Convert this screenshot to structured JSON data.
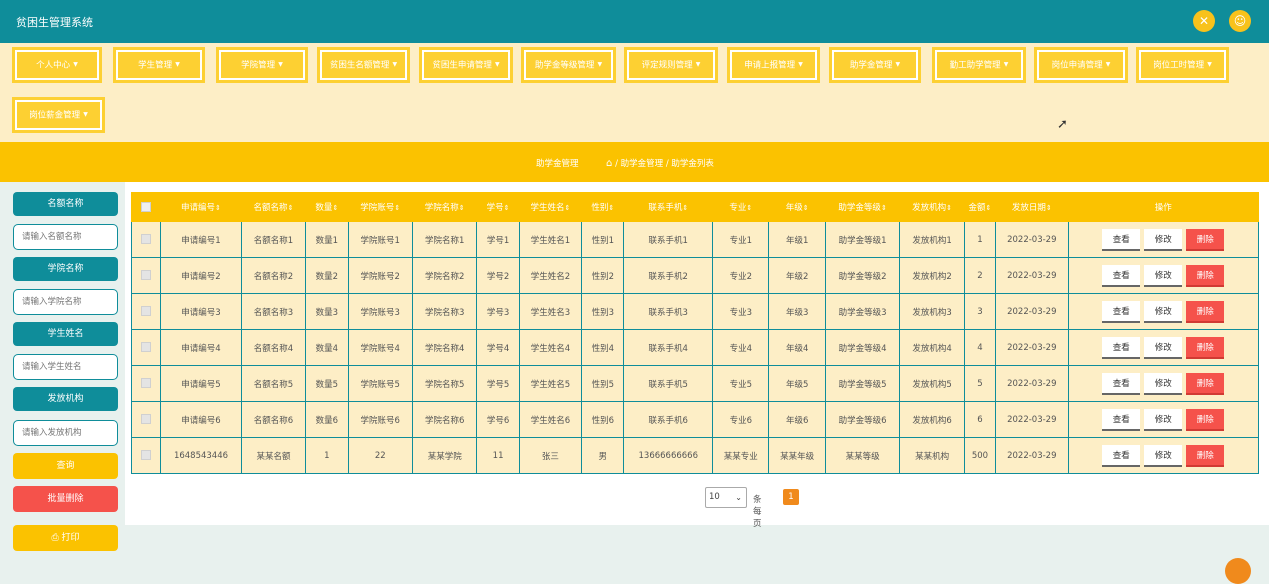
{
  "app": {
    "title": "贫困生管理系统",
    "accent": "#0f8d9a",
    "nav_yellow": "#fdd032",
    "danger": "#f5524b"
  },
  "top_icons": [
    "fullscreen-icon",
    "user-icon"
  ],
  "nav": [
    "个人中心",
    "学生管理",
    "学院管理",
    "贫困生名额管理",
    "贫困生申请管理",
    "助学金等级管理",
    "评定规则管理",
    "申请上报管理",
    "助学金管理",
    "勤工助学管理",
    "岗位申请管理",
    "岗位工时管理",
    "岗位薪金管理"
  ],
  "breadcrumb": {
    "title": "助学金管理",
    "path": "/ 助学金管理 / 助学金列表"
  },
  "filters": [
    {
      "label": "名额名称",
      "placeholder": "请输入名额名称"
    },
    {
      "label": "学院名称",
      "placeholder": "请输入学院名称"
    },
    {
      "label": "学生姓名",
      "placeholder": "请输入学生姓名"
    },
    {
      "label": "发放机构",
      "placeholder": "请输入发放机构"
    }
  ],
  "buttons": {
    "search": "查询",
    "batch_delete": "批量删除",
    "print": "打印"
  },
  "table": {
    "columns": [
      "申请编号",
      "名额名称",
      "数量",
      "学院账号",
      "学院名称",
      "学号",
      "学生姓名",
      "性别",
      "联系手机",
      "专业",
      "年级",
      "助学金等级",
      "发放机构",
      "金额",
      "发放日期",
      "操作"
    ],
    "ops": {
      "view": "查看",
      "edit": "修改",
      "delete": "删除"
    },
    "rows": [
      [
        "申请编号1",
        "名额名称1",
        "数量1",
        "学院账号1",
        "学院名称1",
        "学号1",
        "学生姓名1",
        "性别1",
        "联系手机1",
        "专业1",
        "年级1",
        "助学金等级1",
        "发放机构1",
        "1",
        "2022-03-29"
      ],
      [
        "申请编号2",
        "名额名称2",
        "数量2",
        "学院账号2",
        "学院名称2",
        "学号2",
        "学生姓名2",
        "性别2",
        "联系手机2",
        "专业2",
        "年级2",
        "助学金等级2",
        "发放机构2",
        "2",
        "2022-03-29"
      ],
      [
        "申请编号3",
        "名额名称3",
        "数量3",
        "学院账号3",
        "学院名称3",
        "学号3",
        "学生姓名3",
        "性别3",
        "联系手机3",
        "专业3",
        "年级3",
        "助学金等级3",
        "发放机构3",
        "3",
        "2022-03-29"
      ],
      [
        "申请编号4",
        "名额名称4",
        "数量4",
        "学院账号4",
        "学院名称4",
        "学号4",
        "学生姓名4",
        "性别4",
        "联系手机4",
        "专业4",
        "年级4",
        "助学金等级4",
        "发放机构4",
        "4",
        "2022-03-29"
      ],
      [
        "申请编号5",
        "名额名称5",
        "数量5",
        "学院账号5",
        "学院名称5",
        "学号5",
        "学生姓名5",
        "性别5",
        "联系手机5",
        "专业5",
        "年级5",
        "助学金等级5",
        "发放机构5",
        "5",
        "2022-03-29"
      ],
      [
        "申请编号6",
        "名额名称6",
        "数量6",
        "学院账号6",
        "学院名称6",
        "学号6",
        "学生姓名6",
        "性别6",
        "联系手机6",
        "专业6",
        "年级6",
        "助学金等级6",
        "发放机构6",
        "6",
        "2022-03-29"
      ],
      [
        "1648543446",
        "某某名额",
        "1",
        "22",
        "某某学院",
        "11",
        "张三",
        "男",
        "13666666666",
        "某某专业",
        "某某年级",
        "某某等级",
        "某某机构",
        "500",
        "2022-03-29"
      ]
    ]
  },
  "pager": {
    "page_size": "10",
    "per_page_text": "条每页",
    "current_page": "1"
  }
}
